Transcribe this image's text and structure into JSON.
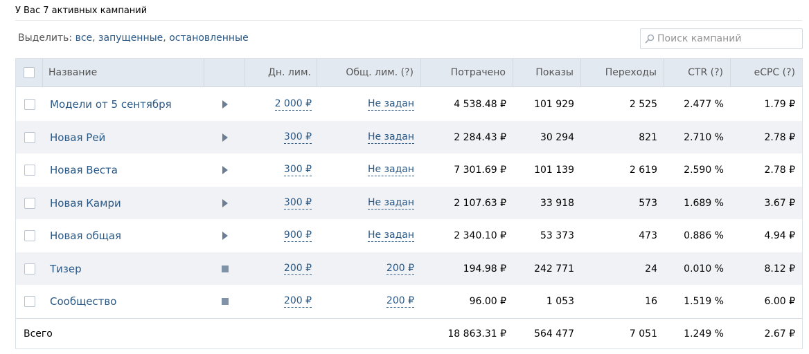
{
  "summary": "У Вас 7 активных кампаний",
  "select": {
    "label": "Выделить:",
    "all": "все",
    "running": "запущенные",
    "stopped": "остановленные",
    "sep": ","
  },
  "search": {
    "placeholder": "Поиск кампаний",
    "icon": "search-icon"
  },
  "table": {
    "headers": {
      "name": "Название",
      "day_limit": "Дн. лим.",
      "total_limit": "Общ. лим. (?)",
      "spent": "Потрачено",
      "shows": "Показы",
      "clicks": "Переходы",
      "ctr": "CTR (?)",
      "ecpc": "eCPC (?)"
    },
    "rows": [
      {
        "name": "Модели от 5 сентября",
        "status": "stopped",
        "status_icon": "play-icon",
        "day_limit": "2 000 ₽",
        "total_limit": "Не задан",
        "spent": "4 538.48 ₽",
        "shows": "101 929",
        "clicks": "2 525",
        "ctr": "2.477 %",
        "ecpc": "1.79 ₽"
      },
      {
        "name": "Новая Рей",
        "status": "stopped",
        "status_icon": "play-icon",
        "day_limit": "300 ₽",
        "total_limit": "Не задан",
        "spent": "2 284.43 ₽",
        "shows": "30 294",
        "clicks": "821",
        "ctr": "2.710 %",
        "ecpc": "2.78 ₽"
      },
      {
        "name": "Новая Веста",
        "status": "stopped",
        "status_icon": "play-icon",
        "day_limit": "300 ₽",
        "total_limit": "Не задан",
        "spent": "7 301.69 ₽",
        "shows": "101 139",
        "clicks": "2 619",
        "ctr": "2.590 %",
        "ecpc": "2.78 ₽"
      },
      {
        "name": "Новая Камри",
        "status": "stopped",
        "status_icon": "play-icon",
        "day_limit": "300 ₽",
        "total_limit": "Не задан",
        "spent": "2 107.63 ₽",
        "shows": "33 918",
        "clicks": "573",
        "ctr": "1.689 %",
        "ecpc": "3.67 ₽"
      },
      {
        "name": "Новая общая",
        "status": "stopped",
        "status_icon": "play-icon",
        "day_limit": "900 ₽",
        "total_limit": "Не задан",
        "spent": "2 340.10 ₽",
        "shows": "53 373",
        "clicks": "473",
        "ctr": "0.886 %",
        "ecpc": "4.94 ₽"
      },
      {
        "name": "Тизер",
        "status": "running",
        "status_icon": "stop-icon",
        "day_limit": "200 ₽",
        "total_limit": "200 ₽",
        "spent": "194.98 ₽",
        "shows": "242 771",
        "clicks": "24",
        "ctr": "0.010 %",
        "ecpc": "8.12 ₽"
      },
      {
        "name": "Сообщество",
        "status": "running",
        "status_icon": "stop-icon",
        "day_limit": "200 ₽",
        "total_limit": "200 ₽",
        "spent": "96.00 ₽",
        "shows": "1 053",
        "clicks": "16",
        "ctr": "1.519 %",
        "ecpc": "6.00 ₽"
      }
    ],
    "total": {
      "label": "Всего",
      "spent": "18 863.31 ₽",
      "shows": "564 477",
      "clicks": "7 051",
      "ctr": "1.249 %",
      "ecpc": "2.67 ₽"
    }
  },
  "colors": {
    "link": "#2a5885",
    "header_bg": "#e3e9f1",
    "stripe_bg": "#f0f2f5",
    "border": "#d3d9de",
    "icon": "#6b7d93"
  }
}
